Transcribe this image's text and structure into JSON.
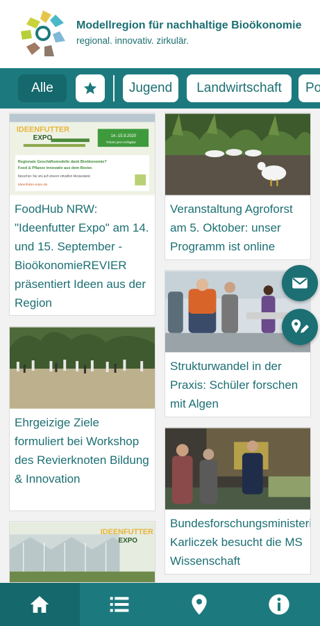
{
  "header": {
    "title": "Modellregion für nachhaltige Bioökonomie",
    "subtitle": "regional. innovativ. zirkulär.",
    "logo_icon": "modellregion-logo"
  },
  "filters": {
    "active": "Alle",
    "favorites_icon": "star-icon",
    "items": [
      "Jugend",
      "Landwirtschaft",
      "Po"
    ]
  },
  "cards": [
    {
      "title": "FoodHub NRW: \"Ideenfutter Expo\" am 14. und 15. September - BioökonomieREVIER präsentiert Ideen aus der Region",
      "image": {
        "brand": "IDEENFUTTER",
        "expo": "EXPO",
        "date": "14.-15.9.2020",
        "ticket": "Tickets jetzt verfügbar",
        "line1": "Regionale Geschäftsmodelle dank Bioökonomie?",
        "line2": "Food & Pflanze innovativ aus dem Revier.",
        "line3": "Besuchen Sie uns auf unserer virtuellen Messestand.",
        "url": "ideenfutter-expo.de"
      }
    },
    {
      "title": "Veranstaltung Agroforst am 5. Oktober: unser Programm ist online"
    },
    {
      "title": "Ehrgeizige Ziele formuliert bei Workshop des Revierknoten Bildung & Innovation"
    },
    {
      "title": "Strukturwandel in der Praxis: Schüler forschen mit Algen"
    },
    {
      "title": "",
      "image": {
        "brand": "IDEENFUTTER",
        "expo": "EXPO"
      }
    },
    {
      "title": "Bundesforschungsministerin Karliczek besucht die MS Wissenschaft"
    }
  ],
  "fabs": [
    "mail-icon",
    "map-pin-edit-icon"
  ],
  "bottom_nav": [
    {
      "icon": "home-icon",
      "active": true
    },
    {
      "icon": "list-icon",
      "active": false
    },
    {
      "icon": "map-pin-icon",
      "active": false
    },
    {
      "icon": "info-icon",
      "active": false
    }
  ],
  "colors": {
    "primary": "#1c7a7e",
    "primary_dark": "#15686b",
    "text": "#1c6f73",
    "background": "#f2f2f2"
  }
}
